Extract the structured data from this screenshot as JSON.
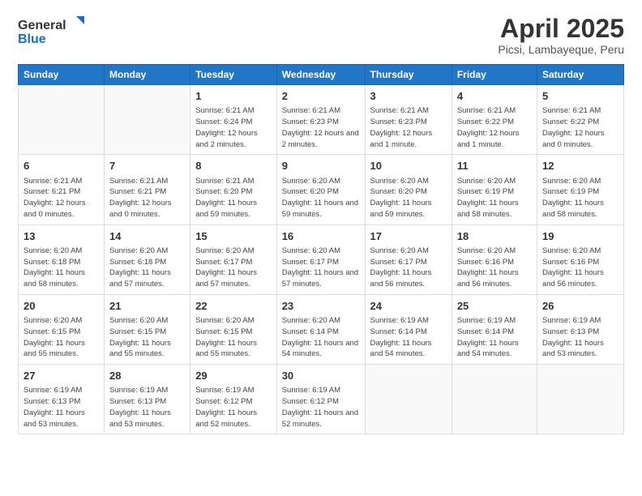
{
  "logo": {
    "general": "General",
    "blue": "Blue"
  },
  "header": {
    "title": "April 2025",
    "subtitle": "Picsi, Lambayeque, Peru"
  },
  "weekdays": [
    "Sunday",
    "Monday",
    "Tuesday",
    "Wednesday",
    "Thursday",
    "Friday",
    "Saturday"
  ],
  "weeks": [
    [
      {
        "day": "",
        "info": ""
      },
      {
        "day": "",
        "info": ""
      },
      {
        "day": "1",
        "info": "Sunrise: 6:21 AM\nSunset: 6:24 PM\nDaylight: 12 hours and 2 minutes."
      },
      {
        "day": "2",
        "info": "Sunrise: 6:21 AM\nSunset: 6:23 PM\nDaylight: 12 hours and 2 minutes."
      },
      {
        "day": "3",
        "info": "Sunrise: 6:21 AM\nSunset: 6:23 PM\nDaylight: 12 hours and 1 minute."
      },
      {
        "day": "4",
        "info": "Sunrise: 6:21 AM\nSunset: 6:22 PM\nDaylight: 12 hours and 1 minute."
      },
      {
        "day": "5",
        "info": "Sunrise: 6:21 AM\nSunset: 6:22 PM\nDaylight: 12 hours and 0 minutes."
      }
    ],
    [
      {
        "day": "6",
        "info": "Sunrise: 6:21 AM\nSunset: 6:21 PM\nDaylight: 12 hours and 0 minutes."
      },
      {
        "day": "7",
        "info": "Sunrise: 6:21 AM\nSunset: 6:21 PM\nDaylight: 12 hours and 0 minutes."
      },
      {
        "day": "8",
        "info": "Sunrise: 6:21 AM\nSunset: 6:20 PM\nDaylight: 11 hours and 59 minutes."
      },
      {
        "day": "9",
        "info": "Sunrise: 6:20 AM\nSunset: 6:20 PM\nDaylight: 11 hours and 59 minutes."
      },
      {
        "day": "10",
        "info": "Sunrise: 6:20 AM\nSunset: 6:20 PM\nDaylight: 11 hours and 59 minutes."
      },
      {
        "day": "11",
        "info": "Sunrise: 6:20 AM\nSunset: 6:19 PM\nDaylight: 11 hours and 58 minutes."
      },
      {
        "day": "12",
        "info": "Sunrise: 6:20 AM\nSunset: 6:19 PM\nDaylight: 11 hours and 58 minutes."
      }
    ],
    [
      {
        "day": "13",
        "info": "Sunrise: 6:20 AM\nSunset: 6:18 PM\nDaylight: 11 hours and 58 minutes."
      },
      {
        "day": "14",
        "info": "Sunrise: 6:20 AM\nSunset: 6:18 PM\nDaylight: 11 hours and 57 minutes."
      },
      {
        "day": "15",
        "info": "Sunrise: 6:20 AM\nSunset: 6:17 PM\nDaylight: 11 hours and 57 minutes."
      },
      {
        "day": "16",
        "info": "Sunrise: 6:20 AM\nSunset: 6:17 PM\nDaylight: 11 hours and 57 minutes."
      },
      {
        "day": "17",
        "info": "Sunrise: 6:20 AM\nSunset: 6:17 PM\nDaylight: 11 hours and 56 minutes."
      },
      {
        "day": "18",
        "info": "Sunrise: 6:20 AM\nSunset: 6:16 PM\nDaylight: 11 hours and 56 minutes."
      },
      {
        "day": "19",
        "info": "Sunrise: 6:20 AM\nSunset: 6:16 PM\nDaylight: 11 hours and 56 minutes."
      }
    ],
    [
      {
        "day": "20",
        "info": "Sunrise: 6:20 AM\nSunset: 6:15 PM\nDaylight: 11 hours and 55 minutes."
      },
      {
        "day": "21",
        "info": "Sunrise: 6:20 AM\nSunset: 6:15 PM\nDaylight: 11 hours and 55 minutes."
      },
      {
        "day": "22",
        "info": "Sunrise: 6:20 AM\nSunset: 6:15 PM\nDaylight: 11 hours and 55 minutes."
      },
      {
        "day": "23",
        "info": "Sunrise: 6:20 AM\nSunset: 6:14 PM\nDaylight: 11 hours and 54 minutes."
      },
      {
        "day": "24",
        "info": "Sunrise: 6:19 AM\nSunset: 6:14 PM\nDaylight: 11 hours and 54 minutes."
      },
      {
        "day": "25",
        "info": "Sunrise: 6:19 AM\nSunset: 6:14 PM\nDaylight: 11 hours and 54 minutes."
      },
      {
        "day": "26",
        "info": "Sunrise: 6:19 AM\nSunset: 6:13 PM\nDaylight: 11 hours and 53 minutes."
      }
    ],
    [
      {
        "day": "27",
        "info": "Sunrise: 6:19 AM\nSunset: 6:13 PM\nDaylight: 11 hours and 53 minutes."
      },
      {
        "day": "28",
        "info": "Sunrise: 6:19 AM\nSunset: 6:13 PM\nDaylight: 11 hours and 53 minutes."
      },
      {
        "day": "29",
        "info": "Sunrise: 6:19 AM\nSunset: 6:12 PM\nDaylight: 11 hours and 52 minutes."
      },
      {
        "day": "30",
        "info": "Sunrise: 6:19 AM\nSunset: 6:12 PM\nDaylight: 11 hours and 52 minutes."
      },
      {
        "day": "",
        "info": ""
      },
      {
        "day": "",
        "info": ""
      },
      {
        "day": "",
        "info": ""
      }
    ]
  ]
}
